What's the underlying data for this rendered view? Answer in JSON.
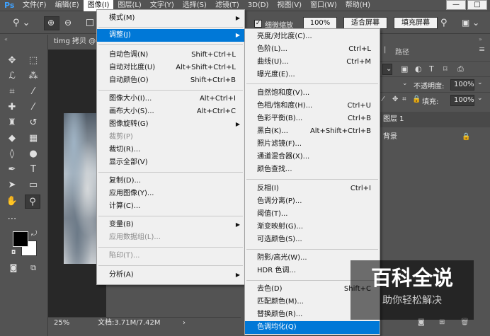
{
  "app": {
    "logo": "Ps"
  },
  "menubar": {
    "items": [
      {
        "label": "文件(F)"
      },
      {
        "label": "编辑(E)"
      },
      {
        "label": "图像(I)"
      },
      {
        "label": "图层(L)"
      },
      {
        "label": "文字(Y)"
      },
      {
        "label": "选择(S)"
      },
      {
        "label": "滤镜(T)"
      },
      {
        "label": "3D(D)"
      },
      {
        "label": "视图(V)"
      },
      {
        "label": "窗口(W)"
      },
      {
        "label": "帮助(H)"
      }
    ],
    "window_buttons": {
      "minimize": "—",
      "restore": "□"
    }
  },
  "options_bar": {
    "scrubby_zoom_label": "细微缩放",
    "zoom_value": "100%",
    "fit_screen_label": "适合屏幕",
    "fill_screen_label": "填充屏幕"
  },
  "document": {
    "tab_title": "timg 拷贝 @",
    "zoom": "25%",
    "doc_size": "文档:3.71M/7.42M"
  },
  "right_panel": {
    "paths_tab": "路径",
    "opacity_label": "不透明度:",
    "opacity_value": "100%",
    "fill_label": "填充:",
    "fill_value": "100%",
    "layers": [
      {
        "name": "图层 1"
      },
      {
        "name": "背景"
      }
    ]
  },
  "image_menu": {
    "items": [
      {
        "label": "模式(M)",
        "submenu": true
      },
      {
        "label": "调整(J)",
        "submenu": true,
        "highlighted": true
      },
      {
        "label": "自动色调(N)",
        "shortcut": "Shift+Ctrl+L"
      },
      {
        "label": "自动对比度(U)",
        "shortcut": "Alt+Shift+Ctrl+L"
      },
      {
        "label": "自动颜色(O)",
        "shortcut": "Shift+Ctrl+B"
      },
      {
        "label": "图像大小(I)...",
        "shortcut": "Alt+Ctrl+I"
      },
      {
        "label": "画布大小(S)...",
        "shortcut": "Alt+Ctrl+C"
      },
      {
        "label": "图像旋转(G)",
        "submenu": true
      },
      {
        "label": "裁剪(P)",
        "disabled": true
      },
      {
        "label": "裁切(R)..."
      },
      {
        "label": "显示全部(V)"
      },
      {
        "label": "复制(D)..."
      },
      {
        "label": "应用图像(Y)..."
      },
      {
        "label": "计算(C)..."
      },
      {
        "label": "变量(B)",
        "submenu": true
      },
      {
        "label": "应用数据组(L)...",
        "disabled": true
      },
      {
        "label": "陷印(T)...",
        "disabled": true
      },
      {
        "label": "分析(A)",
        "submenu": true
      }
    ]
  },
  "adjust_menu": {
    "items": [
      {
        "label": "亮度/对比度(C)..."
      },
      {
        "label": "色阶(L)...",
        "shortcut": "Ctrl+L"
      },
      {
        "label": "曲线(U)...",
        "shortcut": "Ctrl+M"
      },
      {
        "label": "曝光度(E)..."
      },
      {
        "label": "自然饱和度(V)..."
      },
      {
        "label": "色相/饱和度(H)...",
        "shortcut": "Ctrl+U"
      },
      {
        "label": "色彩平衡(B)...",
        "shortcut": "Ctrl+B"
      },
      {
        "label": "黑白(K)...",
        "shortcut": "Alt+Shift+Ctrl+B"
      },
      {
        "label": "照片滤镜(F)..."
      },
      {
        "label": "通道混合器(X)..."
      },
      {
        "label": "颜色查找..."
      },
      {
        "label": "反相(I)",
        "shortcut": "Ctrl+I"
      },
      {
        "label": "色调分离(P)..."
      },
      {
        "label": "阈值(T)..."
      },
      {
        "label": "渐变映射(G)..."
      },
      {
        "label": "可选颜色(S)..."
      },
      {
        "label": "阴影/高光(W)..."
      },
      {
        "label": "HDR 色调..."
      },
      {
        "label": "去色(D)",
        "shortcut": "Shift+C"
      },
      {
        "label": "匹配颜色(M)..."
      },
      {
        "label": "替换颜色(R)..."
      },
      {
        "label": "色调均化(Q)",
        "highlighted": true
      }
    ]
  },
  "watermark": {
    "title": "百科全说",
    "subtitle": "助你轻松解决"
  },
  "colors": {
    "menu_highlight": "#0078d7",
    "ps_blue": "#3fa2ff",
    "panel_bg": "#535353"
  }
}
